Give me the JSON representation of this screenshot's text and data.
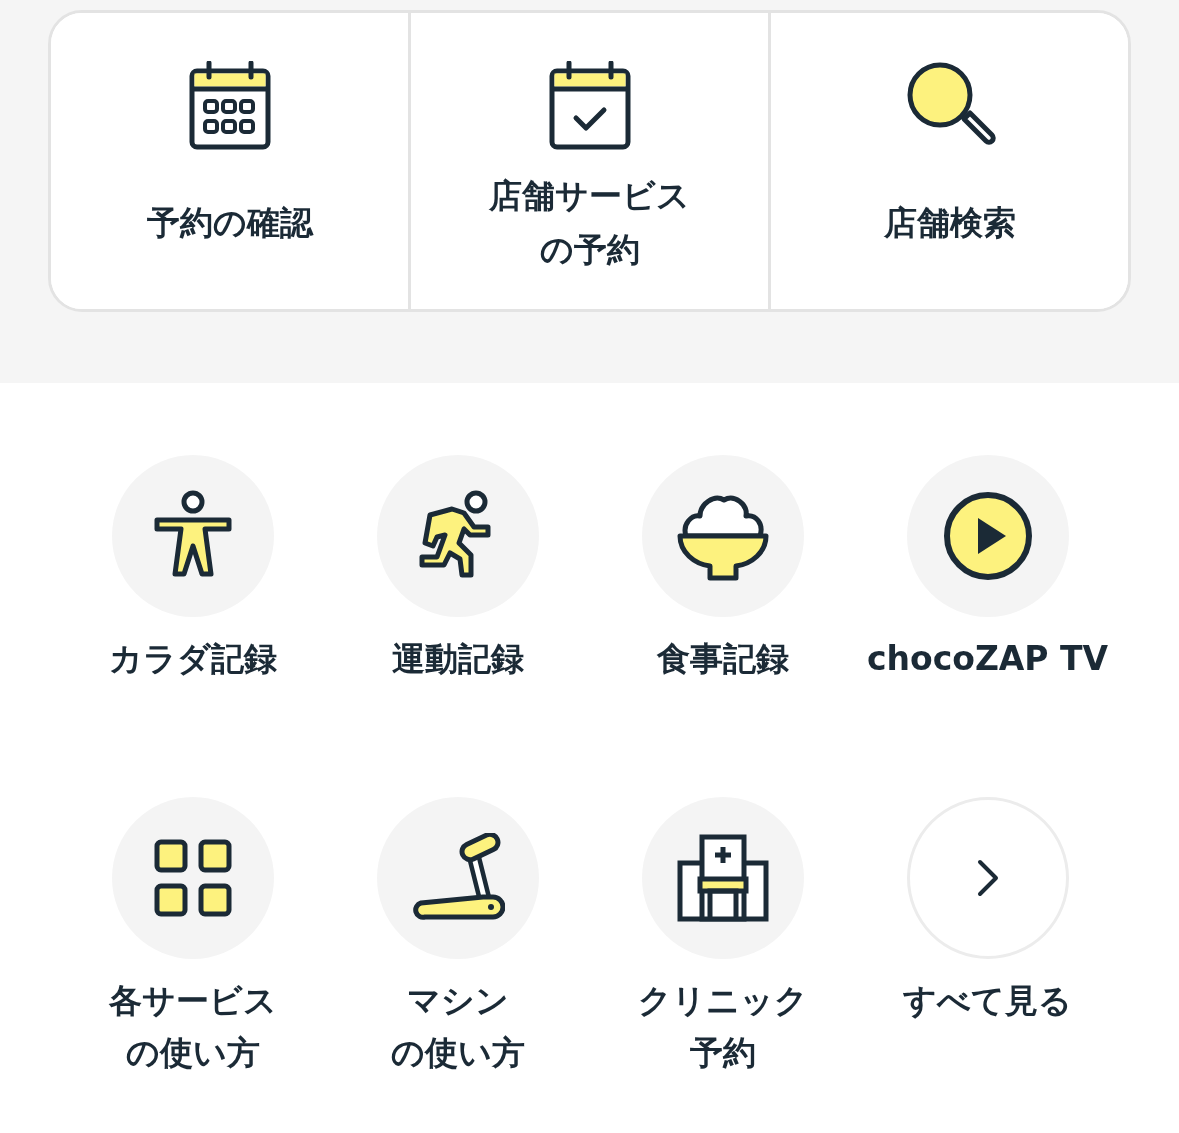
{
  "top_actions": [
    {
      "lines": [
        "予約の確認"
      ]
    },
    {
      "lines": [
        "店舗サービス",
        "の予約"
      ]
    },
    {
      "lines": [
        "店舗検索"
      ]
    }
  ],
  "services": [
    {
      "lines": [
        "カラダ記録"
      ],
      "kind": "normal"
    },
    {
      "lines": [
        "運動記録"
      ],
      "kind": "normal"
    },
    {
      "lines": [
        "食事記録"
      ],
      "kind": "normal"
    },
    {
      "lines": [
        "chocoZAP TV"
      ],
      "kind": "normal"
    },
    {
      "lines": [
        "各サービス",
        "の使い方"
      ],
      "kind": "normal"
    },
    {
      "lines": [
        "マシン",
        "の使い方"
      ],
      "kind": "normal"
    },
    {
      "lines": [
        "クリニック",
        "予約"
      ],
      "kind": "normal"
    },
    {
      "lines": [
        "すべて見る"
      ],
      "kind": "more"
    }
  ]
}
